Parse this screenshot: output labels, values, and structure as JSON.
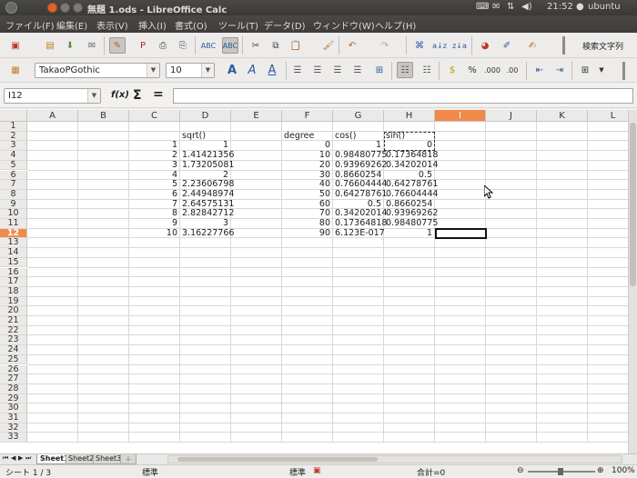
{
  "window": {
    "title": "無題 1.ods - LibreOffice Calc",
    "tray_time": "21:52",
    "tray_user": "ubuntu"
  },
  "menu": [
    "ファイル(F)",
    "編集(E)",
    "表示(V)",
    "挿入(I)",
    "書式(O)",
    "ツール(T)",
    "データ(D)",
    "ウィンドウ(W)",
    "ヘルプ(H)"
  ],
  "toolbar": {
    "search_label": "検索文字列"
  },
  "format": {
    "font_name": "TakaoPGothic",
    "font_size": "10"
  },
  "formula": {
    "cell_ref": "I12",
    "fx_label": "f(x)",
    "sum_label": "Σ",
    "equals_label": "=",
    "content": ""
  },
  "sheet": {
    "columns": [
      "A",
      "B",
      "C",
      "D",
      "E",
      "F",
      "G",
      "H",
      "I",
      "J",
      "K",
      "L"
    ],
    "selected_column": "I",
    "selected_row": 12,
    "row_count": 33,
    "headers": {
      "D2": "sqrt()",
      "F2": "degree",
      "G2": "cos()",
      "H2": "sin()"
    },
    "rows": [
      {
        "c": "1",
        "d": "1",
        "f": "0",
        "g": "1",
        "h": "0"
      },
      {
        "c": "2",
        "d": "1.41421356",
        "f": "10",
        "g": "0.98480775",
        "h": "0.17364818"
      },
      {
        "c": "3",
        "d": "1.73205081",
        "f": "20",
        "g": "0.93969262",
        "h": "0.34202014"
      },
      {
        "c": "4",
        "d": "2",
        "f": "30",
        "g": "0.8660254",
        "h": "0.5"
      },
      {
        "c": "5",
        "d": "2.23606798",
        "f": "40",
        "g": "0.76604444",
        "h": "0.64278761"
      },
      {
        "c": "6",
        "d": "2.44948974",
        "f": "50",
        "g": "0.64278761",
        "h": "0.76604444"
      },
      {
        "c": "7",
        "d": "2.64575131",
        "f": "60",
        "g": "0.5",
        "h": "0.8660254"
      },
      {
        "c": "8",
        "d": "2.82842712",
        "f": "70",
        "g": "0.34202014",
        "h": "0.93969262"
      },
      {
        "c": "9",
        "d": "3",
        "f": "80",
        "g": "0.17364818",
        "h": "0.98480775"
      },
      {
        "c": "10",
        "d": "3.16227766",
        "f": "90",
        "g": "6.123E-017",
        "h": "1"
      }
    ],
    "tabs": [
      "Sheet1",
      "Sheet2",
      "Sheet3"
    ]
  },
  "status": {
    "sheet_info": "シート 1 / 3",
    "page_style": "標準",
    "mode": "標準",
    "sum": "合計=0",
    "zoom": "100%"
  },
  "colors": {
    "accent": "#f08a4b",
    "titlebar": "#3c3b37"
  }
}
